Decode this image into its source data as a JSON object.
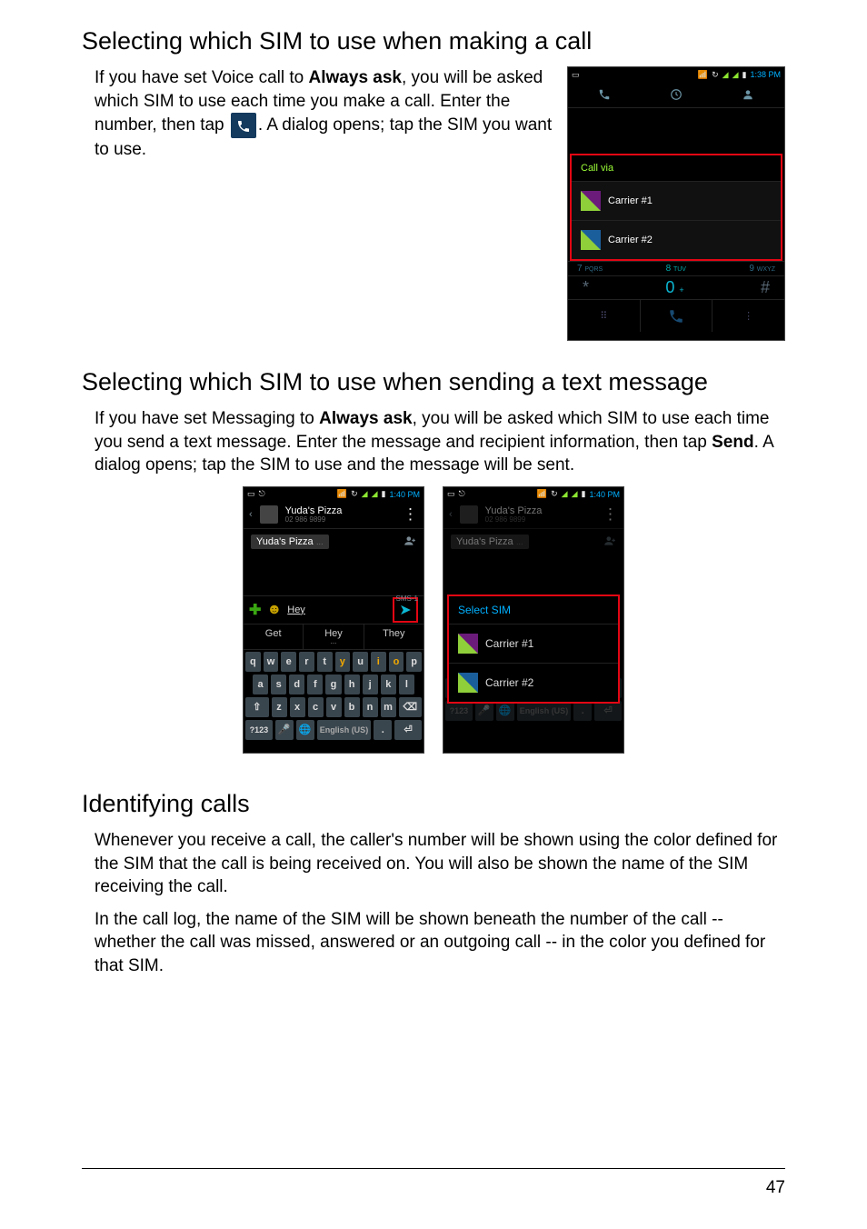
{
  "section1": {
    "heading": "Selecting which SIM to use when making a call",
    "para1_before": "If you have set Voice call to ",
    "para1_bold": "Always ask",
    "para1_after": ", you will be asked which SIM to use each time you make a call. Enter the number, then tap ",
    "para1_trailer": ". A dialog opens; tap the SIM you want to use."
  },
  "dialer": {
    "time": "1:38",
    "time_suffix": "PM",
    "call_via": "Call via",
    "sim1": "Carrier #1",
    "sim2": "Carrier #2",
    "key7": "7",
    "key7_sub": "PQRS",
    "key8": "8",
    "key8_sub": "TUV",
    "key9": "9",
    "key9_sub": "WXYZ",
    "star": "*",
    "zero": "0",
    "zero_sub": "+",
    "hash": "#"
  },
  "section2": {
    "heading": "Selecting which SIM to use when sending a text message",
    "para_before": "If you have set Messaging to ",
    "para_bold": "Always ask",
    "para_mid": ", you will be asked which SIM to use each time you send a text message. Enter the message and recipient information, then tap ",
    "para_bold2": "Send",
    "para_after": ". A dialog opens; tap the SIM to use and the message will be sent."
  },
  "msg": {
    "time": "1:40",
    "time_suffix": "PM",
    "contact": "Yuda's Pizza",
    "contact_num": "02 986 9899",
    "to_chip": "Yuda's Pizza",
    "compose_text": "Hey",
    "sms_badge": "SMS-1",
    "suggest": [
      "Get",
      "Hey",
      "They"
    ],
    "kb_row1": [
      "q",
      "w",
      "e",
      "r",
      "t",
      "y",
      "u",
      "i",
      "o",
      "p"
    ],
    "kb_row2": [
      "a",
      "s",
      "d",
      "f",
      "g",
      "h",
      "j",
      "k",
      "l"
    ],
    "kb_row3_shift": "⇧",
    "kb_row3": [
      "z",
      "x",
      "c",
      "v",
      "b",
      "n",
      "m"
    ],
    "kb_row3_back": "⌫",
    "kb_row4_sym": "?123",
    "kb_row4_space": "English (US)",
    "select_sim_title": "Select SIM",
    "sim1": "Carrier #1",
    "sim2": "Carrier #2"
  },
  "section3": {
    "heading": "Identifying calls",
    "para1": "Whenever you receive a call, the caller's number will be shown using the color defined for the SIM that the call is being received on. You will also be shown the name of the SIM receiving the call.",
    "para2": "In the call log, the name of the SIM will be shown beneath the number of the call -- whether the call was missed, answered or an outgoing call -- in the color you defined for that SIM."
  },
  "page_number": "47"
}
